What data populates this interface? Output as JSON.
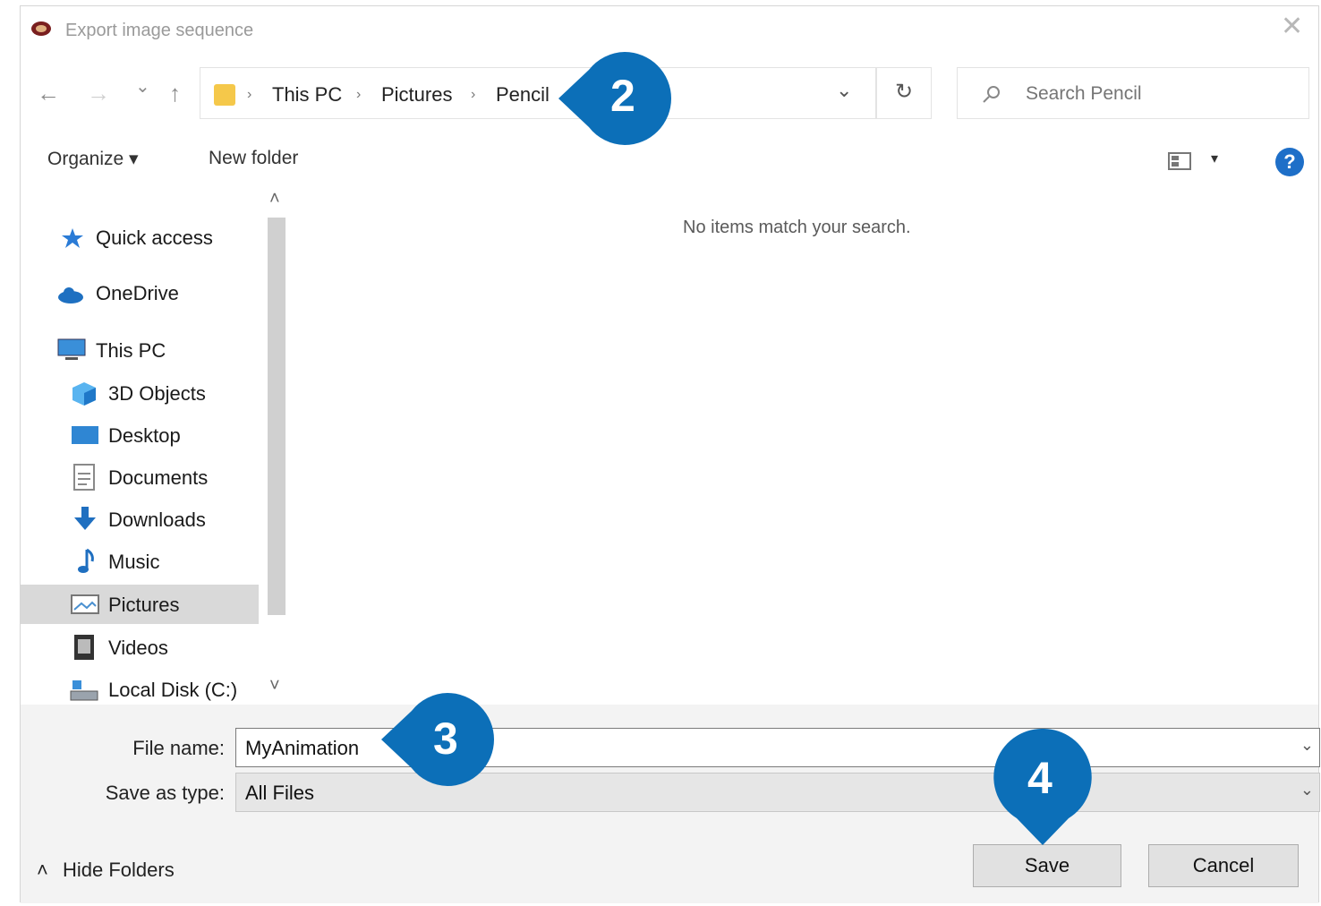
{
  "dialog": {
    "title": "Export image sequence",
    "close_symbol": "✕"
  },
  "nav_buttons": {
    "back": "←",
    "forward": "→",
    "recent": "⌄",
    "up": "↑"
  },
  "address": {
    "crumbs": [
      "This PC",
      "Pictures",
      "Pencil"
    ],
    "separator": "›",
    "dropdown": "⌄",
    "refresh": "↻"
  },
  "search": {
    "placeholder": "Search Pencil"
  },
  "toolbar": {
    "organize": "Organize ▾",
    "new_folder": "New folder",
    "view_dropdown": "▾",
    "help": "?"
  },
  "sidebar": {
    "items": [
      {
        "label": "Quick access",
        "icon": "star-icon"
      },
      {
        "label": "OneDrive",
        "icon": "cloud-icon"
      },
      {
        "label": "This PC",
        "icon": "computer-icon"
      },
      {
        "label": "3D Objects",
        "icon": "cube-icon"
      },
      {
        "label": "Desktop",
        "icon": "desktop-icon"
      },
      {
        "label": "Documents",
        "icon": "document-icon"
      },
      {
        "label": "Downloads",
        "icon": "download-icon"
      },
      {
        "label": "Music",
        "icon": "music-icon"
      },
      {
        "label": "Pictures",
        "icon": "pictures-icon",
        "selected": true
      },
      {
        "label": "Videos",
        "icon": "video-icon"
      },
      {
        "label": "Local Disk (C:)",
        "icon": "disk-icon"
      }
    ],
    "scroll_up": "˄",
    "scroll_down": "˅"
  },
  "content": {
    "empty_message": "No items match your search."
  },
  "form": {
    "file_name_label": "File name:",
    "file_name_value": "MyAnimation",
    "save_as_type_label": "Save as type:",
    "save_as_type_value": "All Files",
    "chevron": "⌄"
  },
  "footer": {
    "hide_folders": "Hide Folders",
    "hide_folders_chevron": "˄",
    "save": "Save",
    "cancel": "Cancel"
  },
  "callouts": [
    {
      "number": "2"
    },
    {
      "number": "3"
    },
    {
      "number": "4"
    }
  ],
  "colors": {
    "callout": "#0c6fb8",
    "folder": "#f5c84a",
    "help": "#1e6fc8",
    "selection": "#d9d9d9"
  }
}
